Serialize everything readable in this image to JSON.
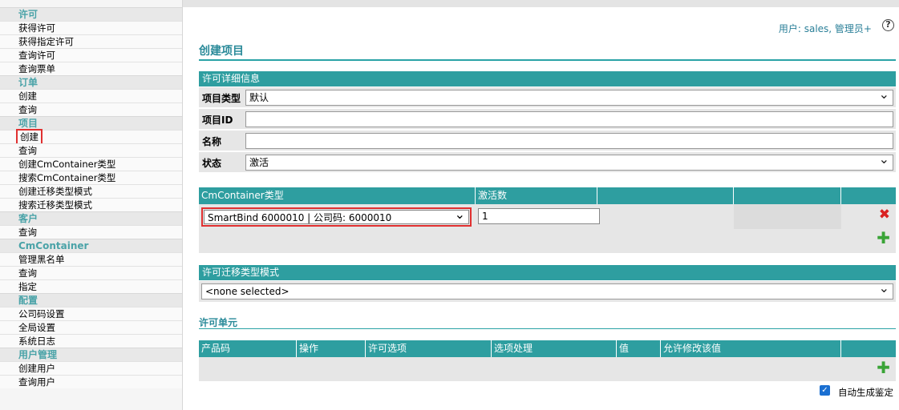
{
  "sidebar": {
    "sections": [
      {
        "title": "许可",
        "items": [
          "获得许可",
          "获得指定许可",
          "查询许可",
          "查询票单"
        ]
      },
      {
        "title": "订单",
        "items": [
          "创建",
          "查询"
        ]
      },
      {
        "title": "项目",
        "items": [
          "创建",
          "查询",
          "创建CmContainer类型",
          "搜索CmContainer类型",
          "创建迁移类型模式",
          "搜索迁移类型模式"
        ]
      },
      {
        "title": "客户",
        "items": [
          "查询"
        ]
      },
      {
        "title": "CmContainer",
        "items": [
          "管理黑名单",
          "查询",
          "指定"
        ]
      },
      {
        "title": "配置",
        "items": [
          "公司码设置",
          "全局设置",
          "系统日志"
        ]
      },
      {
        "title": "用户管理",
        "items": [
          "创建用户",
          "查询用户"
        ]
      }
    ]
  },
  "header": {
    "user_info": "用户: sales, 管理员+",
    "help": "?"
  },
  "page": {
    "title": "创建项目"
  },
  "license_details": {
    "heading": "许可详细信息",
    "rows": [
      {
        "label": "项目类型",
        "value": "默认",
        "type": "select"
      },
      {
        "label": "项目ID",
        "value": "",
        "type": "input"
      },
      {
        "label": "名称",
        "value": "",
        "type": "input"
      },
      {
        "label": "状态",
        "value": "激活",
        "type": "select"
      }
    ]
  },
  "container_table": {
    "headers": [
      "CmContainer类型",
      "激活数",
      "",
      "",
      ""
    ],
    "row": {
      "container_type": "SmartBind 6000010 | 公司码: 6000010",
      "activation_count": "1"
    }
  },
  "migration": {
    "heading": "许可迁移类型模式",
    "value": "<none selected>"
  },
  "license_units": {
    "title": "许可单元",
    "headers": [
      "产品码",
      "操作",
      "许可选项",
      "选项处理",
      "值",
      "允许修改该值",
      ""
    ]
  },
  "auto_generate": {
    "label": "自动生成鉴定",
    "checked": true
  },
  "colors": {
    "accent": "#2e9ea0",
    "section_text": "#4aa3a8",
    "highlight": "#e03030",
    "delete": "#d92121",
    "add": "#3aa437"
  }
}
